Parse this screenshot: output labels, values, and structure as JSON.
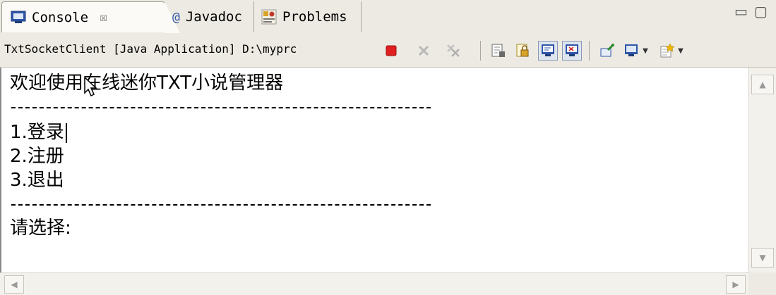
{
  "tabs": [
    {
      "label": "Console",
      "icon": "console-icon",
      "active": true
    },
    {
      "label": "Javadoc",
      "icon": "at-icon"
    },
    {
      "label": "Problems",
      "icon": "problems-icon"
    }
  ],
  "tab_close_glyph": "☒",
  "window_controls": {
    "minimize": "▭",
    "maximize": "▢"
  },
  "toolbar": {
    "process_label": "TxtSocketClient [Java Application] D:\\myprc",
    "buttons": [
      "terminate-icon",
      "remove-launch-icon",
      "remove-all-terminated-icon",
      "scroll-lock-icon",
      "show-when-stdout-icon",
      "show-when-stderr-icon",
      "pin-console-icon",
      "display-console-icon",
      "open-console-icon"
    ],
    "colors": {
      "terminate": "#e02020",
      "accent": "#2e56a8"
    }
  },
  "console": {
    "title_line": "欢迎使用在线迷你TXT小说管理器",
    "dashes": "----------------------------------------",
    "menu": [
      "1.登录",
      "2.注册",
      "3.退出"
    ],
    "prompt": "请选择:"
  },
  "scroll": {
    "up": "▲",
    "down": "▼",
    "left": "◀",
    "right": "▶"
  }
}
